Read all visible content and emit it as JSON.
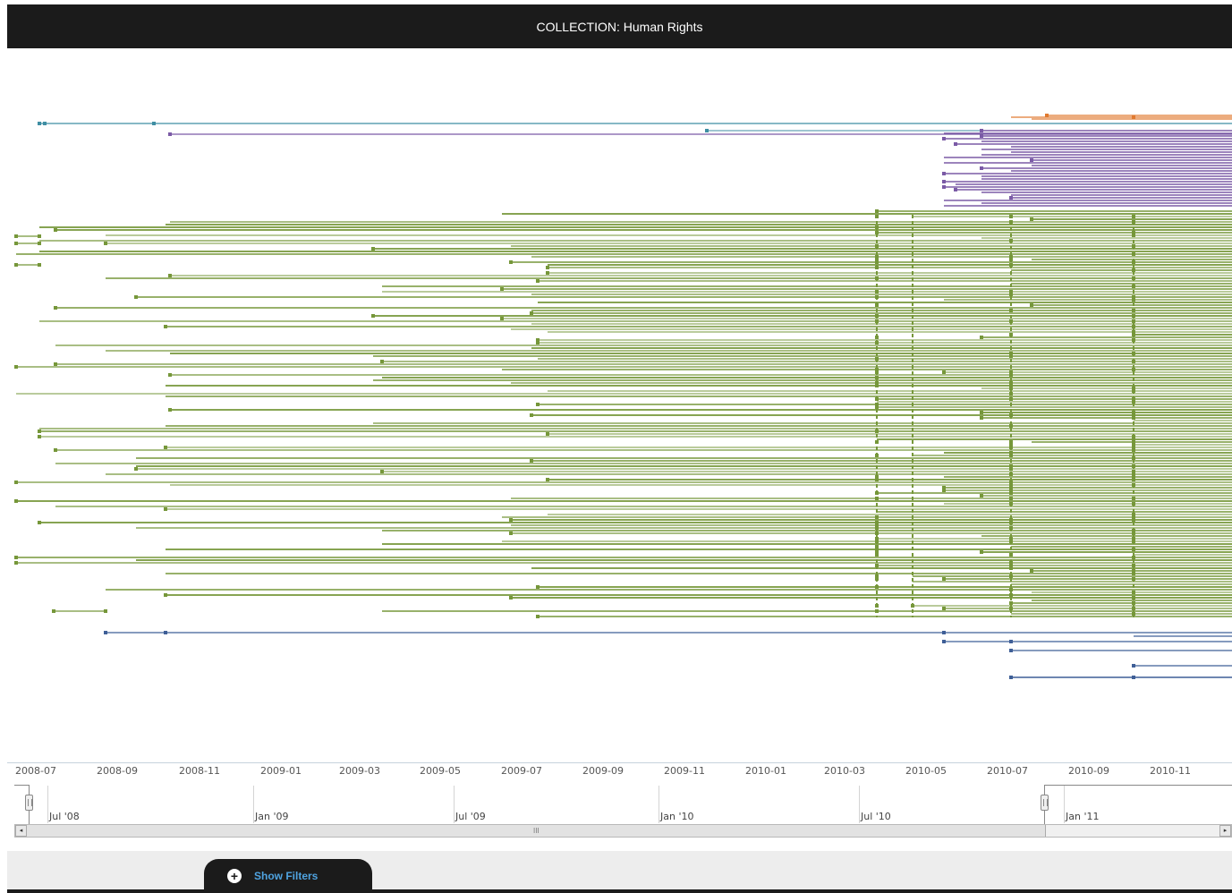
{
  "header": {
    "title": "COLLECTION: Human Rights"
  },
  "colors": {
    "teal": "#3f8ea3",
    "purple": "#7b5ba6",
    "green": "#76973a",
    "blue": "#3f5f97",
    "orange": "#e07a30",
    "header_bg": "#1b1b1b",
    "link": "#4fa3e0"
  },
  "axis": {
    "labels": [
      "2008-07",
      "2008-09",
      "2008-11",
      "2009-01",
      "2009-03",
      "2009-05",
      "2009-07",
      "2009-09",
      "2009-11",
      "2010-01",
      "2010-03",
      "2010-05",
      "2010-07",
      "2010-09",
      "2010-11"
    ]
  },
  "navigator": {
    "labels": [
      "Jul '08",
      "Jan '09",
      "Jul '09",
      "Jan '10",
      "Jul '10",
      "Jan '11"
    ]
  },
  "scrollbar": {
    "grip": "III",
    "left_arrow": "◂",
    "right_arrow": "▸"
  },
  "footer": {
    "tab_icon": "plus-circle-icon",
    "tab_label": "Show Filters",
    "plus_glyph": "+"
  },
  "timeline": {
    "groups": [
      {
        "name": "teal",
        "color": "#3f8ea3",
        "row_start": 138,
        "rows": 2,
        "spacing": 8
      },
      {
        "name": "purple",
        "color": "#7b5ba6",
        "row_start": 146,
        "rows": 30,
        "spacing": 3
      },
      {
        "name": "green",
        "color": "#76973a",
        "row_start": 234,
        "rows": 150,
        "spacing": 3
      },
      {
        "name": "blue",
        "color": "#3f5f97",
        "row_start": 707,
        "rows": 6,
        "spacing": 10
      },
      {
        "name": "orange",
        "color": "#e07a30",
        "row_start": 130,
        "rows": 3,
        "spacing": 2
      }
    ]
  }
}
